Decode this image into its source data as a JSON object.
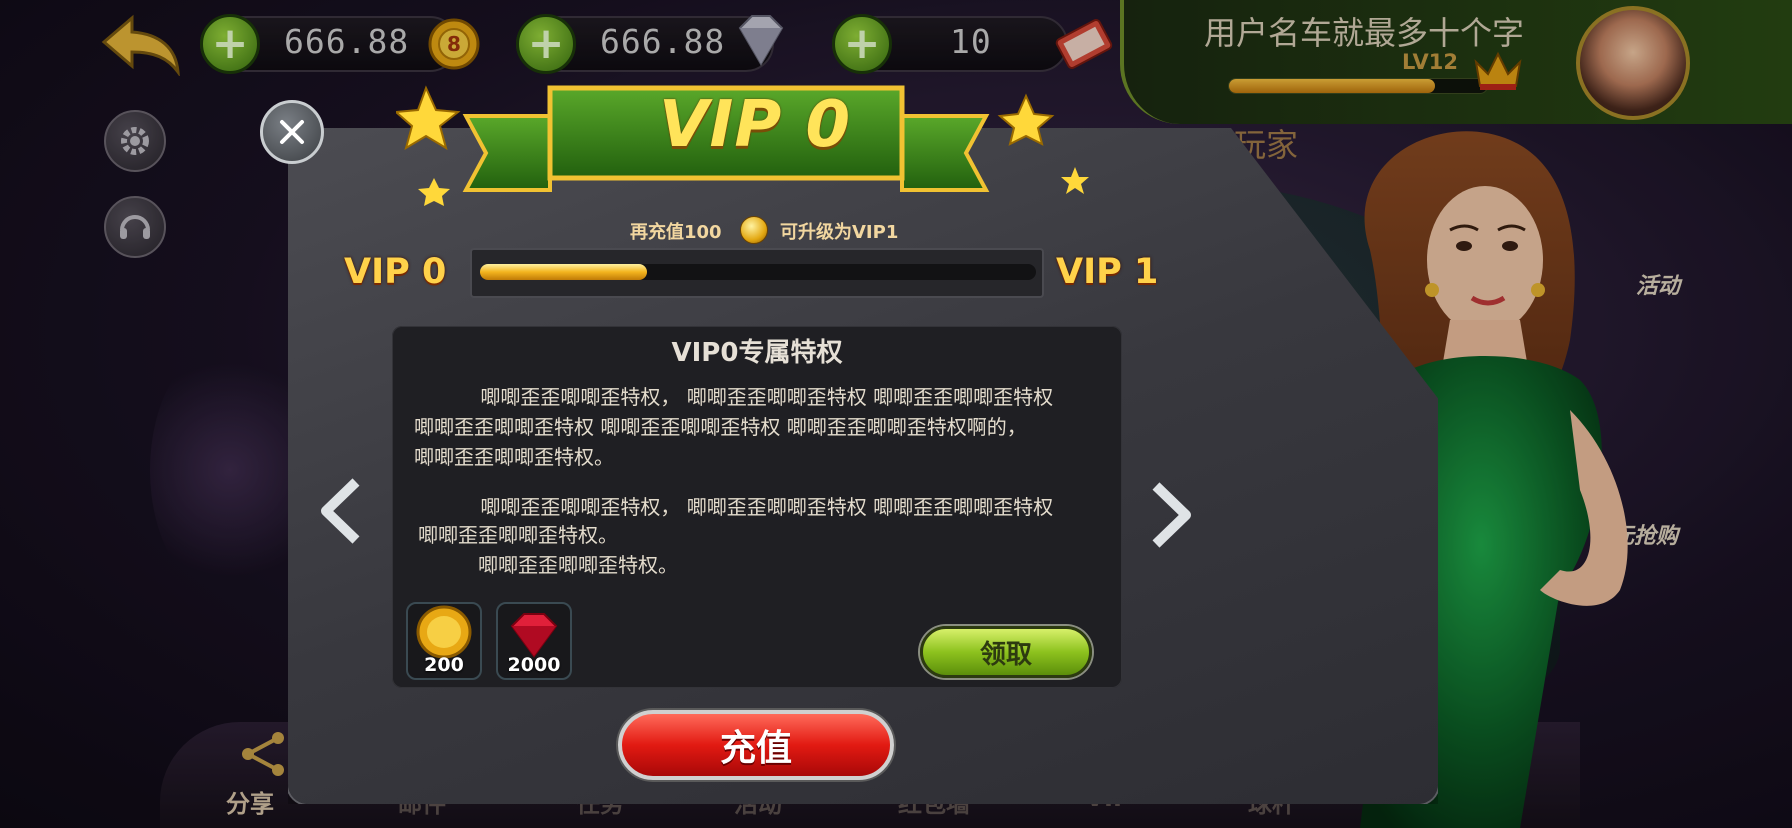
{
  "topbar": {
    "currencies": [
      {
        "value": "666.88",
        "icon": "gold-coin-icon"
      },
      {
        "value": "666.88",
        "icon": "diamond-icon"
      },
      {
        "value": "10",
        "icon": "ticket-icon"
      }
    ],
    "username": "用户名车就最多十个字",
    "level": "LV12",
    "xp_progress": 0.8
  },
  "announcement": "恭喜玩家",
  "side_activities": [
    "活动",
    "元抢购"
  ],
  "bottom_nav": [
    "分享",
    "邮件",
    "任务",
    "活动",
    "红包墙",
    "VIP",
    "球杆"
  ],
  "modal": {
    "title": "VIP 0",
    "tip_before": "再充值100",
    "tip_after": "可升级为VIP1",
    "current_vip": "VIP 0",
    "next_vip": "VIP 1",
    "progress": 0.3,
    "privilege_title": "VIP0专属特权",
    "paragraphs": [
      [
        "　　　 唧唧歪歪唧唧歪特权， 唧唧歪歪唧唧歪特权 唧唧歪歪唧唧歪特权",
        "唧唧歪歪唧唧歪特权 唧唧歪歪唧唧歪特权 唧唧歪歪唧唧歪特权啊的，",
        "唧唧歪歪唧唧歪特权。"
      ],
      [
        "　　　 唧唧歪歪唧唧歪特权， 唧唧歪歪唧唧歪特权 唧唧歪歪唧唧歪特权",
        "唧唧歪歪唧唧歪特权。",
        "　　　唧唧歪歪唧唧歪特权。"
      ]
    ],
    "rewards": [
      {
        "icon": "gold-coin-icon",
        "count": "200"
      },
      {
        "icon": "ruby-gem-icon",
        "count": "2000"
      }
    ],
    "claim_label": "领取",
    "recharge_label": "充值"
  },
  "colors": {
    "accent_green": "#8dc21e",
    "accent_red": "#e21a12",
    "gold": "#ffd24a"
  }
}
